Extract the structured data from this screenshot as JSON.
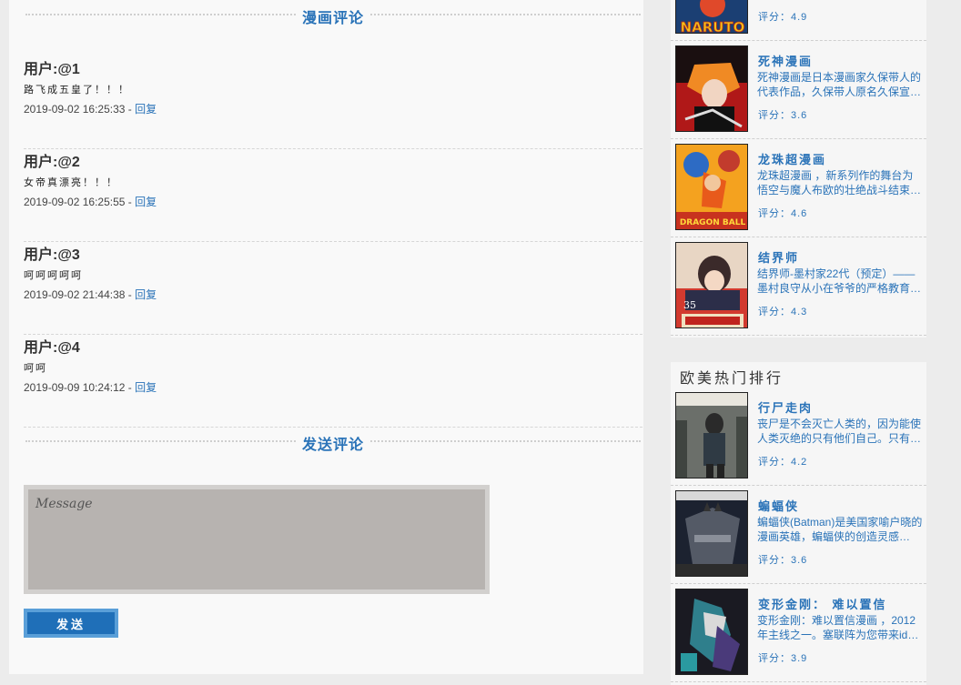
{
  "comments_section": {
    "title": "漫画评论",
    "reply_label": "回复",
    "separator": " - ",
    "items": [
      {
        "user": "用户:@1",
        "text": "路飞成五皇了！！！",
        "time": "2019-09-02 16:25:33"
      },
      {
        "user": "用户:@2",
        "text": "女帝真漂亮！！！",
        "time": "2019-09-02 16:25:55"
      },
      {
        "user": "用户:@3",
        "text": "呵呵呵呵呵",
        "time": "2019-09-02 21:44:38"
      },
      {
        "user": "用户:@4",
        "text": "呵呵",
        "time": "2019-09-09 10:24:12"
      }
    ]
  },
  "post_section": {
    "title": "发送评论",
    "placeholder": "Message",
    "send_label": "发送"
  },
  "sidebar": {
    "block1": {
      "partial_top_score": "评分：4.9",
      "partial_top_cover_text": "NARUTO",
      "items": [
        {
          "name": "死神漫画",
          "desc": "死神漫画是日本漫画家久保带人的代表作品，久保带人原名久保宣…",
          "score": "评分：3.6",
          "icon": "manga-cover"
        },
        {
          "name": "龙珠超漫画",
          "desc": "龙珠超漫画 ，新系列作的舞台为悟空与魔人布欧的壮绝战斗结束…",
          "score": "评分：4.6",
          "icon": "manga-cover",
          "cover_text": "DRAGON BALL"
        },
        {
          "name": "结界师",
          "desc": "结界师-墨村家22代（预定）——墨村良守从小在爷爷的严格教育…",
          "score": "评分：4.3",
          "icon": "manga-cover",
          "cover_text": "35"
        }
      ]
    },
    "block2": {
      "title": "欧美热门排行",
      "items": [
        {
          "name": "行尸走肉",
          "desc": "丧尸是不会灭亡人类的，因为能使人类灭绝的只有他们自己。只有…",
          "score": "评分：4.2",
          "icon": "comic-cover"
        },
        {
          "name": "蝙蝠侠",
          "desc": "蝙蝠侠(Batman)是美国家喻户晓的漫画英雄，蝙蝠侠的创造灵感…",
          "score": "评分：3.6",
          "icon": "comic-cover"
        },
        {
          "name": "变形金刚： 难以置信",
          "desc": "变形金刚：难以置信漫画 ，2012年主线之一。塞联阵为您带来id…",
          "score": "评分：3.9",
          "icon": "comic-cover"
        }
      ]
    }
  }
}
